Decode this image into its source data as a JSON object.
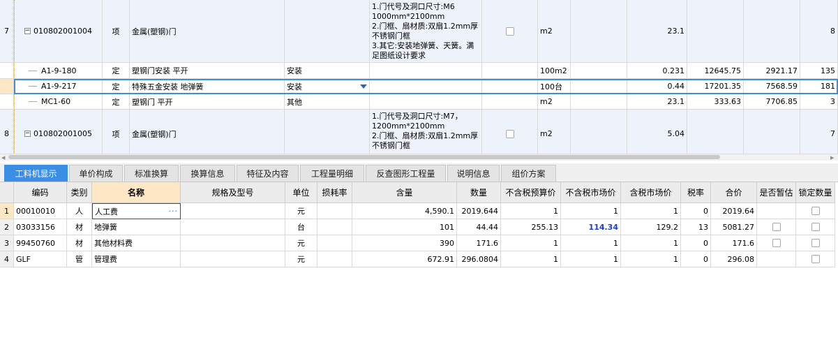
{
  "top_rows": [
    {
      "no": "7",
      "code": "010802001004",
      "expandable": true,
      "type": "项",
      "name": "金属(塑钢)门",
      "category": "",
      "desc": "1.门代号及洞口尺寸:M6 1000mm*2100mm\n2.门框、扇材质:双扇1.2mm厚不锈钢门框\n3.其它:安装地弹簧、天簧。满足图纸设计要求",
      "checkbox": true,
      "unit": "m2",
      "qty": "23.1",
      "price": "",
      "total": "",
      "last": "8"
    },
    {
      "no": "",
      "code": "A1-9-180",
      "expandable": false,
      "type": "定",
      "name": "塑钢门安装 平开",
      "category": "安装",
      "desc": "",
      "checkbox": false,
      "unit": "100m2",
      "qty": "0.231",
      "price": "12645.75",
      "total": "2921.17",
      "last": "135"
    },
    {
      "no": "",
      "code": "A1-9-217",
      "expandable": false,
      "type": "定",
      "name": "特殊五金安装 地弹簧",
      "category": "安装",
      "desc": "",
      "checkbox": false,
      "unit": "100台",
      "qty": "0.44",
      "price": "17201.35",
      "total": "7568.59",
      "last": "181",
      "selected": true
    },
    {
      "no": "",
      "code": "MC1-60",
      "expandable": false,
      "type": "定",
      "name": "塑钢门 平开",
      "category": "其他",
      "desc": "",
      "checkbox": false,
      "unit": "m2",
      "qty": "23.1",
      "price": "333.63",
      "total": "7706.85",
      "last": "3"
    },
    {
      "no": "8",
      "code": "010802001005",
      "expandable": true,
      "type": "项",
      "name": "金属(塑钢)门",
      "category": "",
      "desc": "1.门代号及洞口尺寸:M7，1200mm*2100mm\n2.门框、扇材质:双扇1.2mm厚不锈钢门框",
      "checkbox": true,
      "unit": "m2",
      "qty": "5.04",
      "price": "",
      "total": "",
      "last": "7"
    }
  ],
  "tabs": [
    "工料机显示",
    "单价构成",
    "标准换算",
    "换算信息",
    "特征及内容",
    "工程量明细",
    "反查图形工程量",
    "说明信息",
    "组价方案"
  ],
  "active_tab": "工料机显示",
  "columns": [
    "编码",
    "类别",
    "名称",
    "规格及型号",
    "单位",
    "损耗率",
    "含量",
    "数量",
    "不含税预算价",
    "不含税市场价",
    "含税市场价",
    "税率",
    "合价",
    "是否暂估",
    "锁定数量"
  ],
  "rows": [
    {
      "no": "1",
      "code": "00010010",
      "cat": "人",
      "name": "人工费",
      "spec": "",
      "unit": "元",
      "loss": "",
      "content": "4,590.1",
      "qty": "2019.644",
      "budget": "1",
      "market": "1",
      "market_tax": "1",
      "tax": "0",
      "sum": "2019.64",
      "est": false,
      "lock": true
    },
    {
      "no": "2",
      "code": "03033156",
      "cat": "材",
      "name": "地弹簧",
      "spec": "",
      "unit": "台",
      "loss": "",
      "content": "101",
      "qty": "44.44",
      "budget": "255.13",
      "market": "114.34",
      "market_tax": "129.2",
      "tax": "13",
      "sum": "5081.27",
      "est": true,
      "lock": true
    },
    {
      "no": "3",
      "code": "99450760",
      "cat": "材",
      "name": "其他材料费",
      "spec": "",
      "unit": "元",
      "loss": "",
      "content": "390",
      "qty": "171.6",
      "budget": "1",
      "market": "1",
      "market_tax": "1",
      "tax": "0",
      "sum": "171.6",
      "est": true,
      "lock": true
    },
    {
      "no": "4",
      "code": "GLF",
      "cat": "管",
      "name": "管理费",
      "spec": "",
      "unit": "元",
      "loss": "",
      "content": "672.91",
      "qty": "296.0804",
      "budget": "1",
      "market": "1",
      "market_tax": "1",
      "tax": "0",
      "sum": "296.08",
      "est": false,
      "lock": true
    }
  ],
  "highlight_color": "#1a3fd6",
  "accent_color": "#3a8ee6"
}
